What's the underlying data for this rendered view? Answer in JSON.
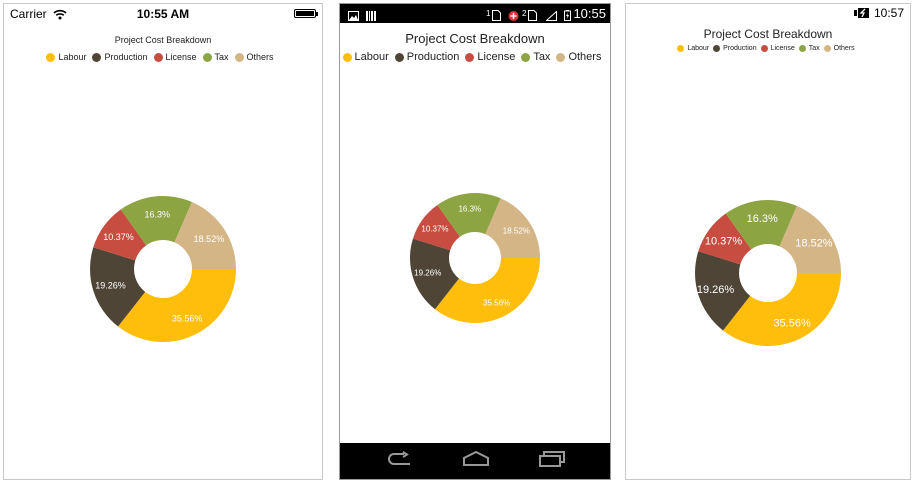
{
  "ios": {
    "carrier": "Carrier",
    "time": "10:55 AM"
  },
  "android": {
    "time": "10:55",
    "notif_count_1": "1",
    "notif_count_2": "2"
  },
  "windows": {
    "time": "10:57"
  },
  "chart_data": [
    {
      "type": "pie",
      "title": "Project Cost Breakdown",
      "categories": [
        "Labour",
        "Production",
        "License",
        "Tax",
        "Others"
      ],
      "values": [
        35.56,
        19.26,
        10.37,
        16.3,
        18.52
      ],
      "labels": [
        "35.56%",
        "19.26%",
        "10.37%",
        "16.3%",
        "18.52%"
      ],
      "colors": [
        "#FFBE0B",
        "#4F4537",
        "#C64D40",
        "#8DA443",
        "#D4B686"
      ],
      "legend": "top-center",
      "donut": true,
      "platform": "iOS"
    },
    {
      "type": "pie",
      "title": "Project Cost Breakdown",
      "categories": [
        "Labour",
        "Production",
        "License",
        "Tax",
        "Others"
      ],
      "values": [
        35.56,
        19.26,
        10.37,
        16.3,
        18.52
      ],
      "labels": [
        "35.56%",
        "19.26%",
        "10.37%",
        "16.3%",
        "18.52%"
      ],
      "colors": [
        "#FFBE0B",
        "#4F4537",
        "#C64D40",
        "#8DA443",
        "#D4B686"
      ],
      "legend": "top-center",
      "donut": true,
      "platform": "Android"
    },
    {
      "type": "pie",
      "title": "Project Cost Breakdown",
      "categories": [
        "Labour",
        "Production",
        "License",
        "Tax",
        "Others"
      ],
      "values": [
        35.56,
        19.26,
        10.37,
        16.3,
        18.52
      ],
      "labels": [
        "35.56%",
        "19.26%",
        "10.37%",
        "16.3%",
        "18.52%"
      ],
      "colors": [
        "#FFBE0B",
        "#4F4537",
        "#C64D40",
        "#8DA443",
        "#D4B686"
      ],
      "legend": "top-center",
      "donut": true,
      "platform": "Windows"
    }
  ]
}
